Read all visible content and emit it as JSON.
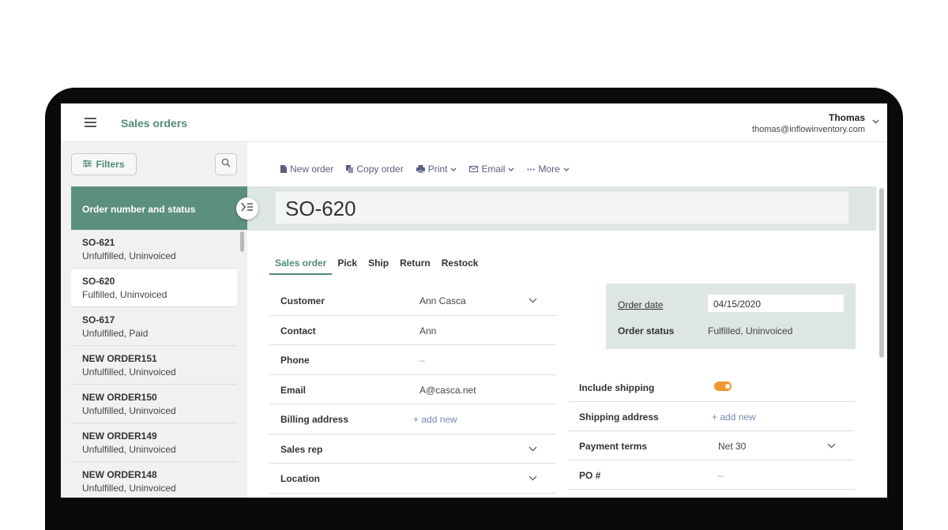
{
  "header": {
    "title": "Sales orders",
    "user_name": "Thomas",
    "user_email": "thomas@inflowinventory.com"
  },
  "sidebar": {
    "filters_label": "Filters",
    "list_header": "Order number and status",
    "orders": [
      {
        "number": "SO-621",
        "status": "Unfulfilled, Uninvoiced"
      },
      {
        "number": "SO-620",
        "status": "Fulfilled, Uninvoiced"
      },
      {
        "number": "SO-617",
        "status": "Unfulfilled, Paid"
      },
      {
        "number": "NEW ORDER151",
        "status": "Unfulfilled, Uninvoiced"
      },
      {
        "number": "NEW ORDER150",
        "status": "Unfulfilled, Uninvoiced"
      },
      {
        "number": "NEW ORDER149",
        "status": "Unfulfilled, Uninvoiced"
      },
      {
        "number": "NEW ORDER148",
        "status": "Unfulfilled, Uninvoiced"
      }
    ]
  },
  "toolbar": {
    "new_order": "New order",
    "copy_order": "Copy order",
    "print": "Print",
    "email": "Email",
    "more": "More"
  },
  "order": {
    "title": "SO-620",
    "tabs": [
      "Sales order",
      "Pick",
      "Ship",
      "Return",
      "Restock"
    ],
    "fields": {
      "customer_label": "Customer",
      "customer_value": "Ann Casca",
      "contact_label": "Contact",
      "contact_value": "Ann",
      "phone_label": "Phone",
      "phone_value": "–",
      "email_label": "Email",
      "email_value": "A@casca.net",
      "billing_label": "Billing address",
      "billing_value": "+ add new",
      "sales_rep_label": "Sales rep",
      "location_label": "Location"
    },
    "summary": {
      "order_date_label": "Order date",
      "order_date_value": "04/15/2020",
      "order_status_label": "Order status",
      "order_status_value": "Fulfilled, Uninvoiced"
    },
    "right_fields": {
      "include_shipping_label": "Include shipping",
      "include_shipping_on": true,
      "shipping_address_label": "Shipping address",
      "shipping_address_value": "+ add new",
      "payment_terms_label": "Payment terms",
      "payment_terms_value": "Net 30",
      "po_label": "PO #",
      "po_value": "–"
    }
  },
  "colors": {
    "accent": "#4f8a78",
    "header_band": "#5c8f7f",
    "toggle": "#f0982f",
    "link": "#7b86b3"
  }
}
